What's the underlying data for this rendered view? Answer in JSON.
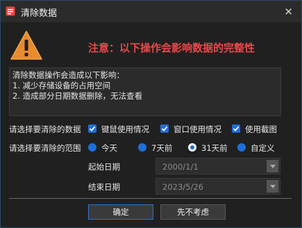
{
  "window": {
    "title": "清除数据",
    "close_glyph": "✕",
    "icon": "app-icon"
  },
  "warning": {
    "icon": "warning-triangle-icon",
    "title": "注意：以下操作会影响数据的完整性"
  },
  "info_lines": [
    "清除数据操作会造成以下影响：",
    "1. 减少存储设备的占用空间",
    "2. 造成部分日期数据删除，无法查看"
  ],
  "data_section": {
    "label": "请选择要清除的数据",
    "options": [
      {
        "label": "键鼠使用情况",
        "checked": true
      },
      {
        "label": "窗口使用情况",
        "checked": true
      },
      {
        "label": "使用截图",
        "checked": true
      }
    ]
  },
  "range_section": {
    "label": "请选择要清除的范围",
    "options": [
      {
        "label": "今天",
        "selected": false
      },
      {
        "label": "7天前",
        "selected": false
      },
      {
        "label": "31天前",
        "selected": true
      },
      {
        "label": "自定义",
        "selected": false
      }
    ]
  },
  "start_date": {
    "label": "起始日期",
    "value": "2000/1/1"
  },
  "end_date": {
    "label": "结束日期",
    "value": "2023/5/26"
  },
  "buttons": {
    "confirm": "确定",
    "cancel": "先不考虑"
  },
  "colors": {
    "accent": "#1e6fd9",
    "warning_text": "#e8494a",
    "warning_icon": "#e88a2e"
  }
}
